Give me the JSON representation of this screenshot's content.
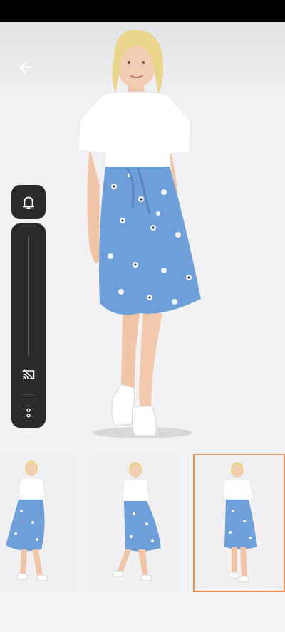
{
  "icons": {
    "back": "arrow-left-icon",
    "bell": "bell-icon",
    "cast": "cast-off-icon",
    "more": "more-vertical-icon"
  },
  "colors": {
    "selected_border": "#ee8f52",
    "panel_bg": "#2b2b2b",
    "skirt": "#6f9fd8",
    "shirt": "#ffffff"
  },
  "gallery": {
    "selected_index": 2,
    "count": 3
  }
}
